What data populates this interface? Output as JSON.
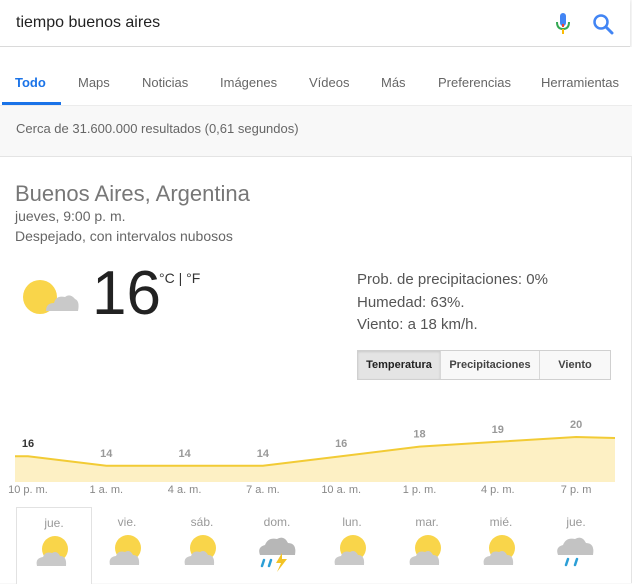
{
  "search": {
    "query": "tiempo buenos aires"
  },
  "tabs": [
    {
      "label": "Todo",
      "active": true
    },
    {
      "label": "Maps"
    },
    {
      "label": "Noticias"
    },
    {
      "label": "Imágenes"
    },
    {
      "label": "Vídeos"
    },
    {
      "label": "Más"
    },
    {
      "label": "Preferencias"
    },
    {
      "label": "Herramientas"
    }
  ],
  "results": {
    "count": "Cerca de 31.600.000 resultados (0,61 segundos)"
  },
  "weather": {
    "location": "Buenos Aires, Argentina",
    "datetime": "jueves, 9:00 p. m.",
    "condition": "Despejado, con intervalos nubosos",
    "temperature": "16",
    "unit_c": "°C",
    "unit_sep": " | ",
    "unit_f": "°F",
    "precipitation": "Prob. de precipitaciones: 0%",
    "humidity": "Humedad: 63%.",
    "wind": "Viento: a 18 km/h.",
    "toggle": [
      "Temperatura",
      "Precipitaciones",
      "Viento"
    ],
    "icon": "partly-cloudy-icon"
  },
  "chart_data": {
    "type": "area",
    "x": [
      "10 p. m.",
      "1 a. m.",
      "4 a. m.",
      "7 a. m.",
      "10 a. m.",
      "1 p. m.",
      "4 p. m.",
      "7 p. m"
    ],
    "values": [
      16,
      14,
      14,
      14,
      16,
      18,
      19,
      20
    ],
    "fill_color": "#fdf0c4",
    "line_color": "#f2cb35"
  },
  "days": [
    {
      "label": "jue.",
      "icon": "partly-cloudy-icon",
      "active": true
    },
    {
      "label": "vie.",
      "icon": "partly-cloudy-icon"
    },
    {
      "label": "sáb.",
      "icon": "partly-cloudy-icon"
    },
    {
      "label": "dom.",
      "icon": "thunderstorm-icon"
    },
    {
      "label": "lun.",
      "icon": "partly-cloudy-icon"
    },
    {
      "label": "mar.",
      "icon": "partly-cloudy-icon"
    },
    {
      "label": "mié.",
      "icon": "partly-cloudy-icon"
    },
    {
      "label": "jue.",
      "icon": "rain-icon"
    }
  ]
}
